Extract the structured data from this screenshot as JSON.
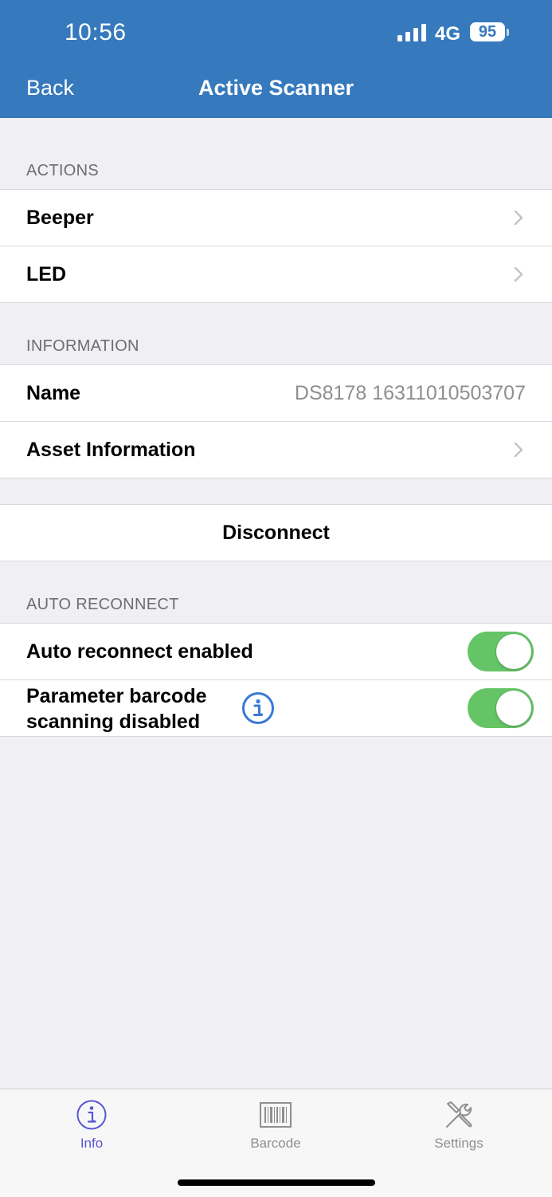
{
  "status_bar": {
    "time": "10:56",
    "network": "4G",
    "battery": "95"
  },
  "nav": {
    "back_label": "Back",
    "title": "Active Scanner"
  },
  "sections": {
    "actions": {
      "header": "ACTIONS",
      "items": [
        {
          "label": "Beeper"
        },
        {
          "label": "LED"
        }
      ]
    },
    "information": {
      "header": "INFORMATION",
      "name_label": "Name",
      "name_value": "DS8178 16311010503707",
      "asset_label": "Asset Information"
    },
    "disconnect": {
      "label": "Disconnect"
    },
    "auto_reconnect": {
      "header": "AUTO RECONNECT",
      "enabled_label": "Auto reconnect enabled",
      "enabled_on": true,
      "param_label_line1": "Parameter barcode",
      "param_label_line2": "scanning disabled",
      "param_on": true
    }
  },
  "tabbar": {
    "tabs": [
      {
        "label": "Info",
        "icon": "info-icon",
        "active": true
      },
      {
        "label": "Barcode",
        "icon": "barcode-icon",
        "active": false
      },
      {
        "label": "Settings",
        "icon": "tools-icon",
        "active": false
      }
    ]
  },
  "colors": {
    "nav_background": "#3679bd",
    "toggle_on": "#65c466",
    "info_accent": "#3a78d8",
    "active_tab": "#5856d6",
    "inactive_tab": "#8e8e93"
  }
}
